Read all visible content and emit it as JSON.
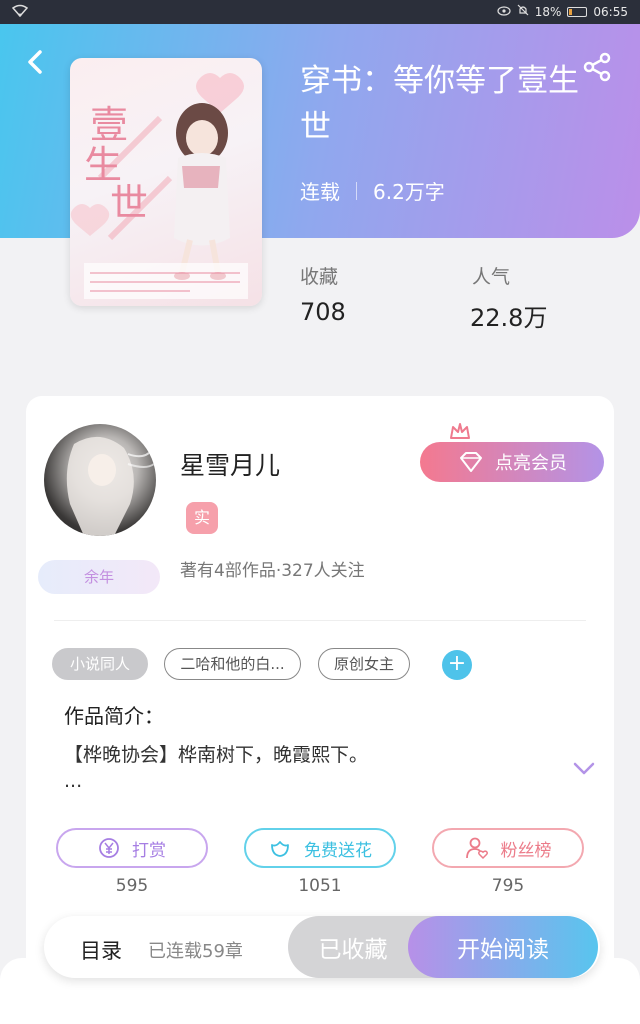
{
  "status_bar": {
    "battery": "18%",
    "time": "06:55",
    "battery_level": 0.18
  },
  "book": {
    "title": "穿书：等你等了壹生世",
    "status": "连载",
    "word_count": "6.2万字",
    "cover_title": "壹生世",
    "stats": [
      {
        "label": "收藏",
        "value": "708"
      },
      {
        "label": "人气",
        "value": "22.8万"
      }
    ]
  },
  "author": {
    "name": "星雪月儿",
    "real_tag": "实",
    "badge": "余年",
    "summary": "著有4部作品·327人关注",
    "vip_button": "点亮会员"
  },
  "tags": [
    "小说同人",
    "二哈和他的白...",
    "原创女主"
  ],
  "intro": {
    "heading": "作品简介：",
    "text": "【桦晚协会】桦南树下，晚霞熙下。",
    "ellipsis": "..."
  },
  "actions": [
    {
      "label": "打赏",
      "count": "595"
    },
    {
      "label": "免费送花",
      "count": "1051"
    },
    {
      "label": "粉丝榜",
      "count": "795"
    }
  ],
  "bottom": {
    "toc": "目录",
    "chapters": "已连载59章",
    "favorited": "已收藏",
    "read": "开始阅读"
  },
  "colors": {
    "header_start": "#49c6ee",
    "header_end": "#bb8fe9",
    "vip_start": "#f4798f",
    "vip_end": "#b393e7",
    "add_tag": "#4ec3ea"
  }
}
